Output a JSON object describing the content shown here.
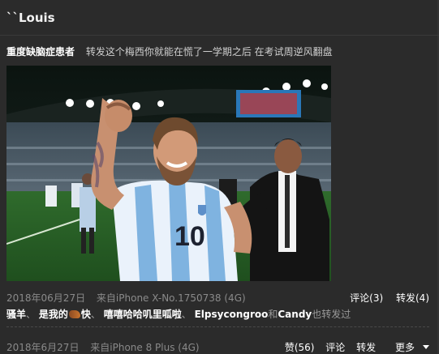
{
  "post": {
    "title": "``Louis",
    "repost_author": "重度缺脑症患者",
    "repost_text": "转发这个梅西你就能在慌了一学期之后 在考试周逆风翻盘",
    "image_caption": "",
    "meta": {
      "date": "2018年06月27日",
      "source": "来自iPhone X-No.1750738 (4G)",
      "comment": "评论(3)",
      "repost": "转发(4)"
    },
    "reposters": {
      "user1": "骚羊",
      "user2_prefix": "是我的",
      "user2_suffix": "快",
      "user3": "嘻嘻哈哈叽里呱啦",
      "user4": "Elpsycongroo",
      "and_word": "和",
      "user5": "Candy",
      "tail": "也转发过",
      "comma": "、"
    }
  },
  "original": {
    "date": "2018年6月27日",
    "source": "来自iPhone 8 Plus (4G)",
    "like": "赞(56)",
    "comment": "评论",
    "repost": "转发",
    "more": "更多"
  },
  "icons": {
    "more_caret": "caret-down-icon",
    "emoji": "emoji-icon"
  },
  "colors": {
    "background": "#2b2b2b",
    "meta_text": "#8a8a8a",
    "link_text": "#ffffff"
  }
}
